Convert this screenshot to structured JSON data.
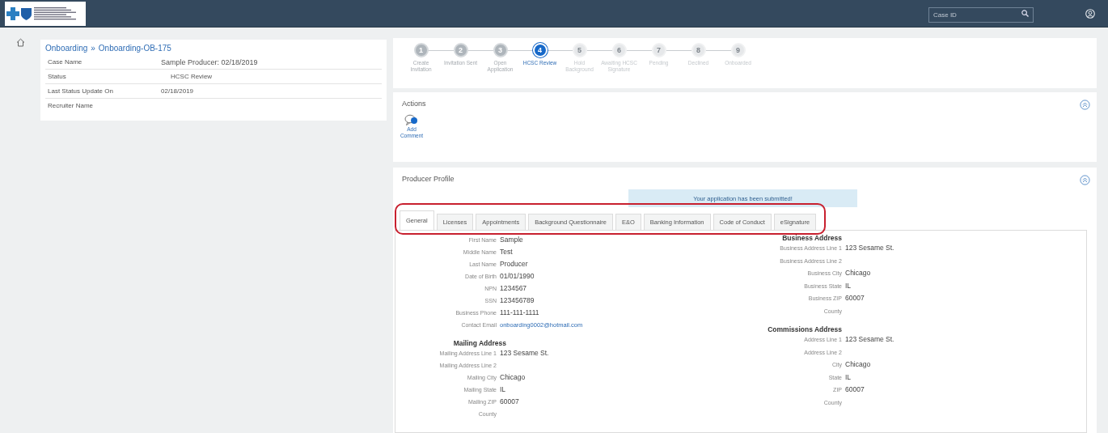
{
  "header": {
    "search": {
      "placeholder": "Case ID"
    }
  },
  "case_summary": {
    "breadcrumb": {
      "items": [
        "Onboarding",
        "Onboarding-OB-175"
      ],
      "separator": "»"
    },
    "rows": [
      {
        "label": "Case Name",
        "value": "Sample Producer: 02/18/2019"
      },
      {
        "label": "Status",
        "value": "HCSC Review"
      },
      {
        "label": "Last Status Update On",
        "value": "02/18/2019"
      },
      {
        "label": "Recruiter Name"
      }
    ]
  },
  "stepper": {
    "steps": [
      {
        "number": "1",
        "label": "Create Invitation",
        "completed": true,
        "selected": false
      },
      {
        "number": "2",
        "label": "Invitation Sent",
        "completed": true,
        "selected": false
      },
      {
        "number": "3",
        "label": "Open Application",
        "completed": true,
        "selected": false
      },
      {
        "number": "4",
        "label": "HCSC Review",
        "completed": false,
        "selected": true
      },
      {
        "number": "5",
        "label": "Hold Background",
        "completed": false,
        "selected": false
      },
      {
        "number": "6",
        "label": "Awaiting HCSC Signature",
        "completed": false,
        "selected": false
      },
      {
        "number": "7",
        "label": "Pending",
        "completed": false,
        "selected": false
      },
      {
        "number": "8",
        "label": "Declined",
        "completed": false,
        "selected": false
      },
      {
        "number": "9",
        "label": "Onboarded",
        "completed": false,
        "selected": false
      }
    ]
  },
  "actions": {
    "title": "Actions",
    "items": [
      {
        "label": "Add Comment"
      }
    ]
  },
  "producer_profile": {
    "title": "Producer Profile",
    "notice": "Your application has been submitted!",
    "tabs": [
      {
        "label": "General",
        "selected": true
      },
      {
        "label": "Licenses",
        "selected": false
      },
      {
        "label": "Appointments",
        "selected": false
      },
      {
        "label": "Background Questionnaire",
        "selected": false
      },
      {
        "label": "E&O",
        "selected": false
      },
      {
        "label": "Banking Information",
        "selected": false
      },
      {
        "label": "Code of Conduct",
        "selected": false
      },
      {
        "label": "eSignature",
        "selected": false
      }
    ],
    "columns": [
      [
        {
          "fields": [
            {
              "label": "First Name",
              "value": "Sample"
            },
            {
              "label": "Middle Name",
              "value": "Test"
            },
            {
              "label": "Last Name",
              "value": "Producer"
            },
            {
              "label": "Date of Birth",
              "value": "01/01/1990"
            },
            {
              "label": "NPN",
              "value": "1234567"
            },
            {
              "label": "SSN",
              "value": "123456789"
            },
            {
              "label": "Business Phone",
              "value": "111-111-1111"
            },
            {
              "label": "Contact Email",
              "value": "onboarding0002@hotmail.com",
              "kind": "link"
            }
          ]
        },
        {
          "heading": "Mailing Address",
          "fields": [
            {
              "label": "Mailing Address Line 1",
              "value": "123 Sesame St."
            },
            {
              "label": "Mailing Address Line 2"
            },
            {
              "label": "Mailing City",
              "value": "Chicago"
            },
            {
              "label": "Mailing State",
              "value": "IL"
            },
            {
              "label": "Mailing ZIP",
              "value": "60007"
            },
            {
              "label": "County"
            }
          ]
        }
      ],
      [
        {
          "heading": "Business Address",
          "fields": [
            {
              "label": "Business Address Line 1",
              "value": "123 Sesame St."
            },
            {
              "label": "Business Address Line 2"
            },
            {
              "label": "Business City",
              "value": "Chicago"
            },
            {
              "label": "Business State",
              "value": "IL"
            },
            {
              "label": "Business ZIP",
              "value": "60007"
            },
            {
              "label": "County"
            }
          ]
        },
        {
          "heading": "Commissions Address",
          "fields": [
            {
              "label": "Address Line 1",
              "value": "123 Sesame St."
            },
            {
              "label": "Address Line 2"
            },
            {
              "label": "City",
              "value": "Chicago"
            },
            {
              "label": "State",
              "value": "IL"
            },
            {
              "label": "ZIP",
              "value": "60007"
            },
            {
              "label": "County"
            }
          ]
        }
      ]
    ]
  }
}
